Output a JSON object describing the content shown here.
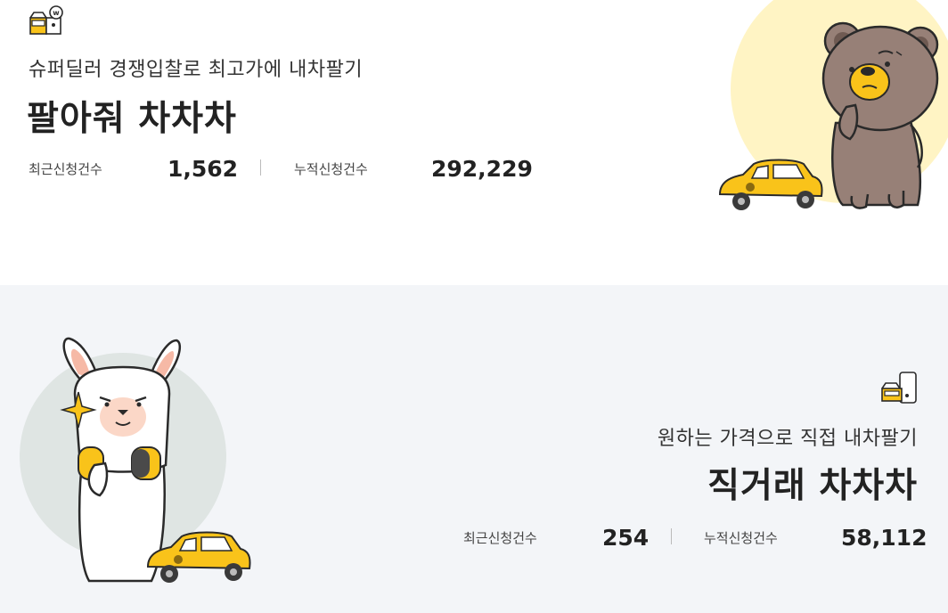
{
  "colors": {
    "accent_yellow": "#f9c31a",
    "sun_yellow": "#fff4c4",
    "bottom_bg": "#f3f5f8",
    "bear_brown": "#978077",
    "alpaca_circle": "#dfe5e3"
  },
  "sell_service": {
    "icon": "car-auction-w-icon",
    "subtitle": "슈퍼딜러 경쟁입찰로 최고가에 내차팔기",
    "title": "팔아줘 차차차",
    "stats": {
      "recent_label": "최근신청건수",
      "recent_value": "1,562",
      "total_label": "누적신청건수",
      "total_value": "292,229"
    },
    "illustration": "bear-with-yellow-car"
  },
  "direct_service": {
    "icon": "car-phone-direct-icon",
    "subtitle": "원하는 가격으로 직접 내차팔기",
    "title": "직거래 차차차",
    "stats": {
      "recent_label": "최근신청건수",
      "recent_value": "254",
      "total_label": "누적신청건수",
      "total_value": "58,112"
    },
    "illustration": "alpaca-with-headphones-and-yellow-car"
  }
}
